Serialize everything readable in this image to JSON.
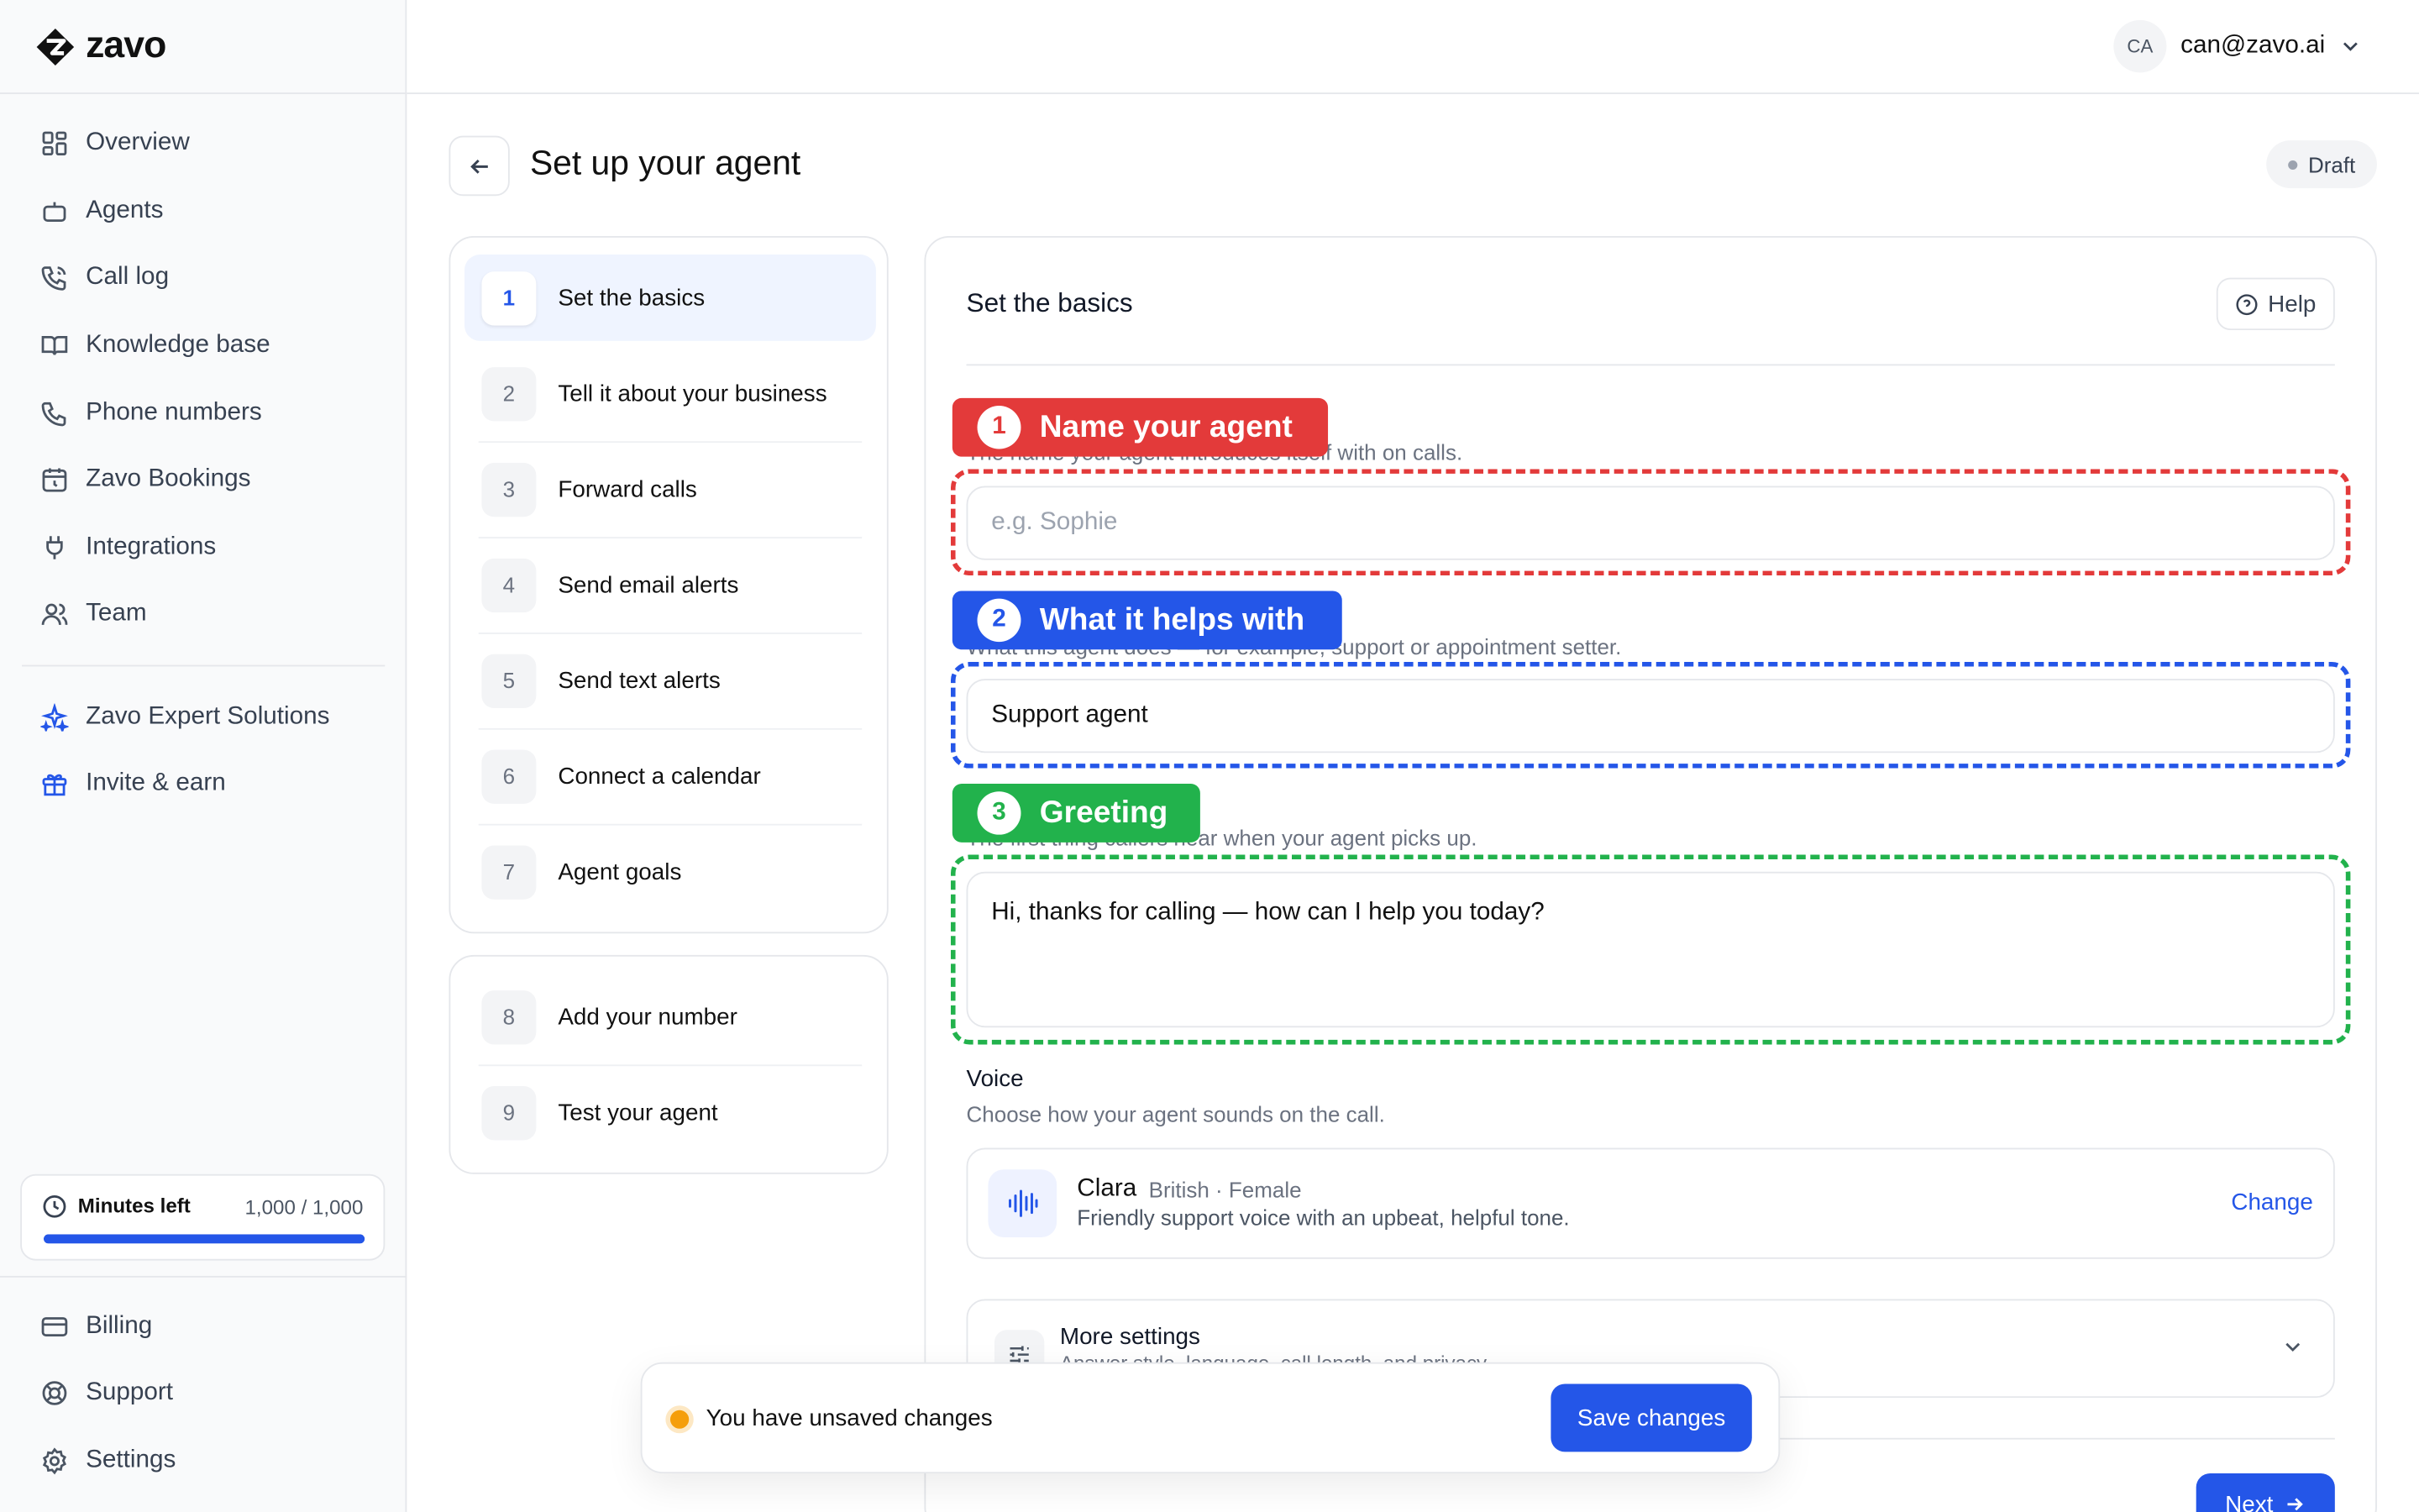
{
  "app": {
    "brand": "zavo"
  },
  "sidebar": {
    "nav": [
      {
        "label": "Overview",
        "icon": "grid-icon"
      },
      {
        "label": "Agents",
        "icon": "bot-icon"
      },
      {
        "label": "Call log",
        "icon": "phone-log-icon"
      },
      {
        "label": "Knowledge base",
        "icon": "book-icon"
      },
      {
        "label": "Phone numbers",
        "icon": "phone-icon"
      },
      {
        "label": "Zavo Bookings",
        "icon": "calendar-icon"
      },
      {
        "label": "Integrations",
        "icon": "plug-icon"
      },
      {
        "label": "Team",
        "icon": "users-icon"
      }
    ],
    "extras": [
      {
        "label": "Zavo Expert Solutions",
        "icon": "sparkles-icon"
      },
      {
        "label": "Invite & earn",
        "icon": "gift-icon"
      }
    ],
    "minutes": {
      "label": "Minutes left",
      "value": "1,000 / 1,000",
      "fraction": 1.0
    },
    "bottom": [
      {
        "label": "Billing",
        "icon": "card-icon"
      },
      {
        "label": "Support",
        "icon": "lifebuoy-icon"
      },
      {
        "label": "Settings",
        "icon": "gear-icon"
      }
    ]
  },
  "header": {
    "avatar_initials": "CA",
    "email": "can@zavo.ai"
  },
  "page": {
    "title": "Set up your agent",
    "status": "Draft"
  },
  "steps": [
    {
      "num": "1",
      "label": "Set the basics",
      "active": true
    },
    {
      "num": "2",
      "label": "Tell it about your business"
    },
    {
      "num": "3",
      "label": "Forward calls"
    },
    {
      "num": "4",
      "label": "Send email alerts"
    },
    {
      "num": "5",
      "label": "Send text alerts"
    },
    {
      "num": "6",
      "label": "Connect a calendar"
    },
    {
      "num": "7",
      "label": "Agent goals"
    }
  ],
  "steps2": [
    {
      "num": "8",
      "label": "Add your number"
    },
    {
      "num": "9",
      "label": "Test your agent"
    }
  ],
  "form": {
    "title": "Set the basics",
    "help": "Help",
    "name": {
      "badge_num": "1",
      "badge_label": "Name your agent",
      "hint": "The name your agent introduces itself with on calls.",
      "placeholder": "e.g. Sophie",
      "value": ""
    },
    "role": {
      "badge_num": "2",
      "badge_label": "What it helps with",
      "hint": "What this agent does — for example, support or appointment setter.",
      "value": "Support agent"
    },
    "greeting": {
      "badge_num": "3",
      "badge_label": "Greeting",
      "hint": "The first thing callers hear when your agent picks up.",
      "value": "Hi, thanks for calling — how can I help you today?"
    },
    "voice": {
      "label": "Voice",
      "hint": "Choose how your agent sounds on the call.",
      "name": "Clara",
      "meta": "British · Female",
      "desc": "Friendly support voice with an upbeat, helpful tone.",
      "change": "Change"
    },
    "more": {
      "title": "More settings",
      "sub": "Answer style, language, call length, and privacy"
    },
    "next": "Next"
  },
  "unsaved": {
    "text": "You have unsaved changes",
    "save": "Save changes"
  },
  "colors": {
    "accent": "#2456e8",
    "badge_red": "#e33a3a",
    "badge_blue": "#2456e8",
    "badge_green": "#22b24c",
    "warning": "#f59e0b"
  }
}
